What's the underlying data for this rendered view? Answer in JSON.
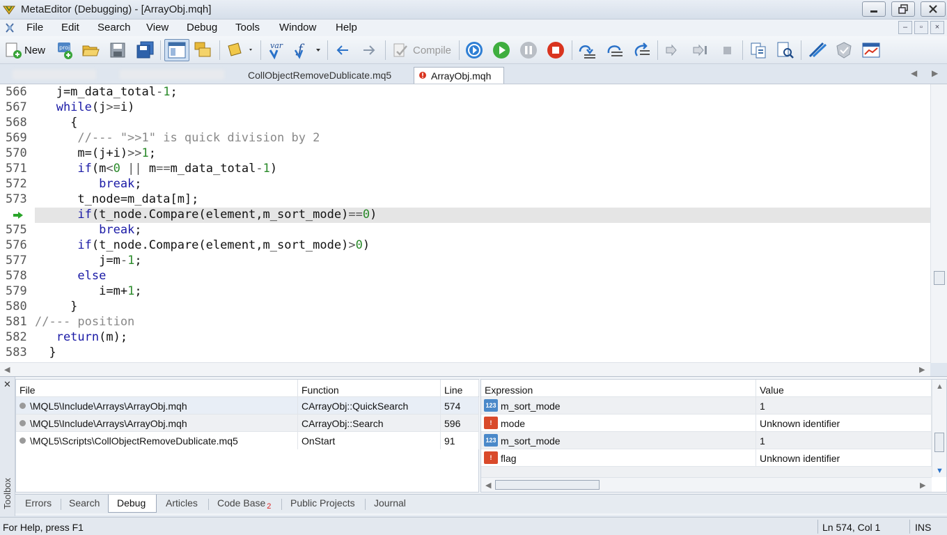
{
  "window": {
    "title": "MetaEditor (Debugging) - [ArrayObj.mqh]"
  },
  "menu": [
    "File",
    "Edit",
    "Search",
    "View",
    "Debug",
    "Tools",
    "Window",
    "Help"
  ],
  "toolbar": {
    "new_label": "New",
    "compile_label": "Compile"
  },
  "tabs": [
    {
      "label": "CollObjectRemoveDublicate.mq5"
    },
    {
      "label": "ArrayObj.mqh"
    }
  ],
  "editor": {
    "current_line_number": 574,
    "lines": [
      {
        "n": "566",
        "t": [
          [
            "",
            "   j=m_data_total"
          ],
          [
            "op",
            "-"
          ],
          [
            "num",
            "1"
          ],
          [
            "",
            ";"
          ]
        ]
      },
      {
        "n": "567",
        "t": [
          [
            "kw",
            "   while"
          ],
          [
            "",
            "(j"
          ],
          [
            "op",
            ">="
          ],
          [
            "",
            "i)"
          ]
        ]
      },
      {
        "n": "568",
        "t": [
          [
            "",
            "     {"
          ]
        ]
      },
      {
        "n": "569",
        "t": [
          [
            "cm",
            "      //--- \">>1\" is quick division by 2"
          ]
        ]
      },
      {
        "n": "570",
        "t": [
          [
            "",
            "      m=(j+i)"
          ],
          [
            "op",
            ">>"
          ],
          [
            "num",
            "1"
          ],
          [
            "",
            ";"
          ]
        ]
      },
      {
        "n": "571",
        "t": [
          [
            "kw",
            "      if"
          ],
          [
            "",
            "(m"
          ],
          [
            "op",
            "<"
          ],
          [
            "num",
            "0"
          ],
          [
            "op",
            " || "
          ],
          [
            "",
            "m"
          ],
          [
            "op",
            "=="
          ],
          [
            "",
            "m_data_total"
          ],
          [
            "op",
            "-"
          ],
          [
            "num",
            "1"
          ],
          [
            "",
            ")"
          ]
        ]
      },
      {
        "n": "572",
        "t": [
          [
            "kw",
            "         break"
          ],
          [
            "",
            ";"
          ]
        ]
      },
      {
        "n": "573",
        "t": [
          [
            "",
            "      t_node=m_data[m];"
          ]
        ]
      },
      {
        "n": "",
        "t": [
          [
            "kw",
            "      if"
          ],
          [
            "",
            "(t_node.Compare(element,m_sort_mode)"
          ],
          [
            "op",
            "=="
          ],
          [
            "num",
            "0"
          ],
          [
            "",
            ")"
          ]
        ]
      },
      {
        "n": "575",
        "t": [
          [
            "kw",
            "         break"
          ],
          [
            "",
            ";"
          ]
        ]
      },
      {
        "n": "576",
        "t": [
          [
            "kw",
            "      if"
          ],
          [
            "",
            "(t_node.Compare(element,m_sort_mode)"
          ],
          [
            "op",
            ">"
          ],
          [
            "num",
            "0"
          ],
          [
            "",
            ")"
          ]
        ]
      },
      {
        "n": "577",
        "t": [
          [
            "",
            "         j=m"
          ],
          [
            "op",
            "-"
          ],
          [
            "num",
            "1"
          ],
          [
            "",
            ";"
          ]
        ]
      },
      {
        "n": "578",
        "t": [
          [
            "kw",
            "      else"
          ]
        ]
      },
      {
        "n": "579",
        "t": [
          [
            "",
            "         i=m+"
          ],
          [
            "num",
            "1"
          ],
          [
            "",
            ";"
          ]
        ]
      },
      {
        "n": "580",
        "t": [
          [
            "",
            "     }"
          ]
        ]
      },
      {
        "n": "581",
        "t": [
          [
            "cm",
            "//--- position"
          ]
        ]
      },
      {
        "n": "582",
        "t": [
          [
            "kw",
            "   return"
          ],
          [
            "",
            "(m);"
          ]
        ]
      },
      {
        "n": "583",
        "t": [
          [
            "",
            "  }"
          ]
        ]
      }
    ]
  },
  "callstack": {
    "headers": {
      "file": "File",
      "function": "Function",
      "line": "Line"
    },
    "rows": [
      {
        "file": "\\MQL5\\Include\\Arrays\\ArrayObj.mqh",
        "function": "CArrayObj::QuickSearch",
        "line": "574"
      },
      {
        "file": "\\MQL5\\Include\\Arrays\\ArrayObj.mqh",
        "function": "CArrayObj::Search",
        "line": "596"
      },
      {
        "file": "\\MQL5\\Scripts\\CollObjectRemoveDublicate.mq5",
        "function": "OnStart",
        "line": "91"
      }
    ]
  },
  "watch": {
    "headers": {
      "expression": "Expression",
      "value": "Value"
    },
    "rows": [
      {
        "icon": "number-icon",
        "expression": "m_sort_mode",
        "value": "1"
      },
      {
        "icon": "error-icon",
        "expression": "mode",
        "value": "Unknown identifier"
      },
      {
        "icon": "number-icon",
        "expression": "m_sort_mode",
        "value": "1"
      },
      {
        "icon": "error-icon",
        "expression": "flag",
        "value": "Unknown identifier"
      }
    ]
  },
  "toolbox": {
    "side_label": "Toolbox",
    "tabs": [
      "Errors",
      "Search",
      "Debug",
      "Articles",
      "Code Base",
      "Public Projects",
      "Journal"
    ],
    "code_base_badge": "2",
    "active_tab": "Debug"
  },
  "status": {
    "help": "For Help, press F1",
    "position": "Ln 574, Col 1",
    "mode": "INS"
  },
  "colors": {
    "keyword": "#1a1aa6",
    "comment": "#888888",
    "number": "#2a8a2a",
    "current_line": "#e5e5e5"
  }
}
